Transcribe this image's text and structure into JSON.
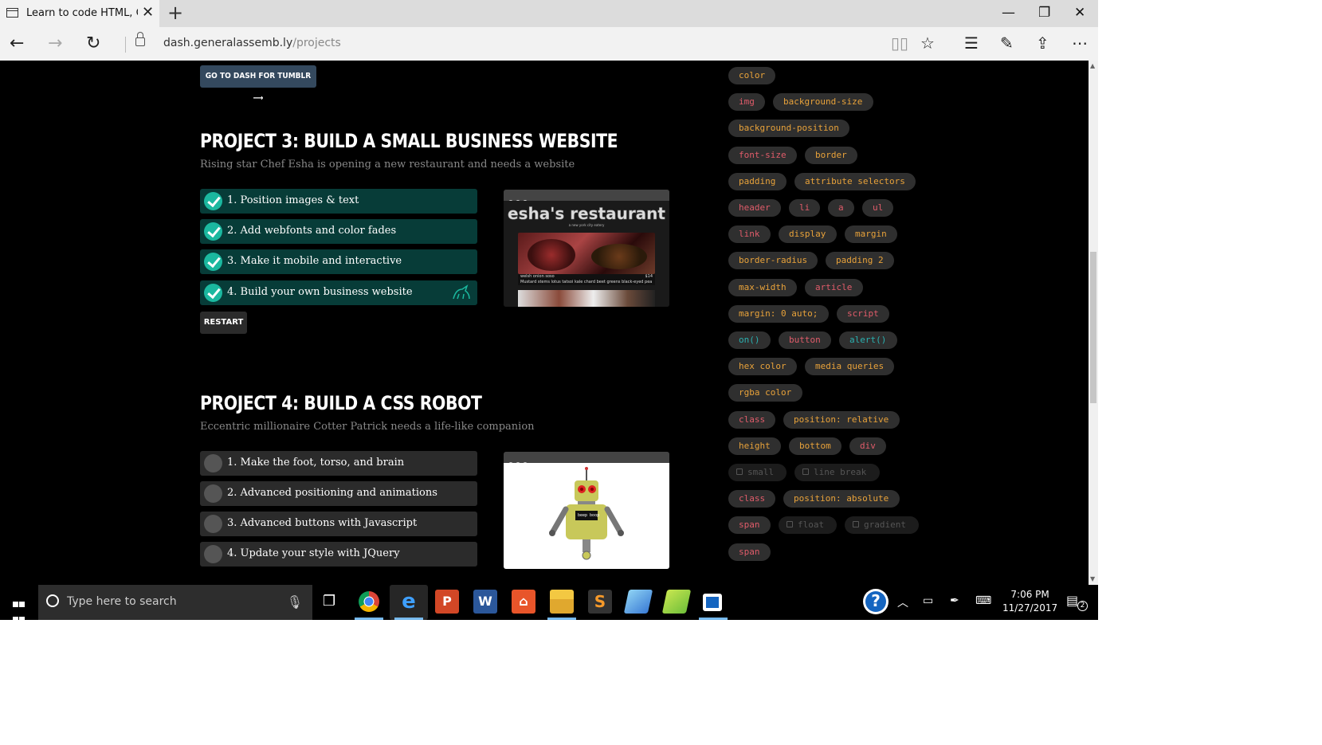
{
  "browser": {
    "tab_title": "Learn to code HTML, CS",
    "url_domain": "dash.generalassemb.ly",
    "url_path": "/projects"
  },
  "page": {
    "tumblr_button": "GO TO DASH FOR TUMBLR ⟶",
    "project3": {
      "title": "PROJECT 3: BUILD A SMALL BUSINESS WEBSITE",
      "subtitle": "Rising star Chef Esha is opening a new restaurant and needs a website",
      "steps": [
        {
          "label": "1. Position images & text",
          "done": true
        },
        {
          "label": "2. Add webfonts and color fades",
          "done": true
        },
        {
          "label": "3. Make it mobile and interactive",
          "done": true
        },
        {
          "label": "4. Build your own business website",
          "done": true
        }
      ],
      "restart": "RESTART",
      "preview_title": "esha's restaurant",
      "preview_tagline": "a new york city eatery",
      "preview_item": "welsh onion soso",
      "preview_price": "$14",
      "preview_desc": "Mustard stems lotus tatsoi kale chard beet greens black-eyed pea sorrel amaranth garlic fiddlehead spring onion summer purslane asparagus lentil."
    },
    "project4": {
      "title": "PROJECT 4: BUILD A CSS ROBOT",
      "subtitle": "Eccentric millionaire Cotter Patrick needs a life-like companion",
      "steps": [
        {
          "label": "1. Make the foot, torso, and brain",
          "done": false
        },
        {
          "label": "2. Advanced positioning and animations",
          "done": false
        },
        {
          "label": "3. Advanced buttons with Javascript",
          "done": false
        },
        {
          "label": "4. Update your style with JQuery",
          "done": false
        }
      ],
      "robot_screen": "beep boop"
    }
  },
  "tags": [
    {
      "label": "color",
      "color": "orange"
    },
    {
      "label": "img",
      "color": "red"
    },
    {
      "label": "background-size",
      "color": "orange"
    },
    {
      "label": "background-position",
      "color": "orange"
    },
    {
      "label": "font-size",
      "color": "red"
    },
    {
      "label": "border",
      "color": "orange"
    },
    {
      "label": "padding",
      "color": "orange"
    },
    {
      "label": "attribute selectors",
      "color": "orange"
    },
    {
      "label": "header",
      "color": "red"
    },
    {
      "label": "li",
      "color": "red"
    },
    {
      "label": "a",
      "color": "red"
    },
    {
      "label": "ul",
      "color": "red"
    },
    {
      "label": "link",
      "color": "red"
    },
    {
      "label": "display",
      "color": "orange"
    },
    {
      "label": "margin",
      "color": "orange"
    },
    {
      "label": "border-radius",
      "color": "orange"
    },
    {
      "label": "padding 2",
      "color": "orange"
    },
    {
      "label": "max-width",
      "color": "orange"
    },
    {
      "label": "article",
      "color": "red"
    },
    {
      "label": "margin: 0 auto;",
      "color": "orange"
    },
    {
      "label": "script",
      "color": "red"
    },
    {
      "label": "on()",
      "color": "teal"
    },
    {
      "label": "button",
      "color": "red"
    },
    {
      "label": "alert()",
      "color": "teal"
    },
    {
      "label": "hex color",
      "color": "orange"
    },
    {
      "label": "media queries",
      "color": "orange"
    },
    {
      "label": "rgba color",
      "color": "orange"
    },
    {
      "label": "class",
      "color": "red"
    },
    {
      "label": "position: relative",
      "color": "orange"
    },
    {
      "label": "height",
      "color": "orange"
    },
    {
      "label": "bottom",
      "color": "orange"
    },
    {
      "label": "div",
      "color": "red"
    },
    {
      "label": "small",
      "color": "locked"
    },
    {
      "label": "line break",
      "color": "locked"
    },
    {
      "label": "class",
      "color": "red"
    },
    {
      "label": "position: absolute",
      "color": "orange"
    },
    {
      "label": "span",
      "color": "red"
    },
    {
      "label": "float",
      "color": "locked"
    },
    {
      "label": "gradient",
      "color": "locked"
    },
    {
      "label": "span",
      "color": "red"
    }
  ],
  "taskbar": {
    "search_placeholder": "Type here to search",
    "time": "7:06 PM",
    "date": "11/27/2017",
    "notification_count": "2"
  },
  "colors": {
    "accent_teal": "#1bb89f",
    "done_row": "#073c38",
    "tag_orange": "#e8a23a",
    "tag_red": "#e05c6a",
    "tag_teal": "#2ab0b0",
    "tumblr_button": "#34495e"
  },
  "icons": {
    "back": "back-arrow-icon",
    "forward": "forward-arrow-icon",
    "refresh": "refresh-icon",
    "lock": "lock-icon",
    "reading_view": "reading-view-icon",
    "favorite": "star-icon",
    "hub": "hub-icon",
    "notes": "web-note-icon",
    "share": "share-icon",
    "more": "more-icon",
    "unicorn": "unicorn-icon"
  }
}
